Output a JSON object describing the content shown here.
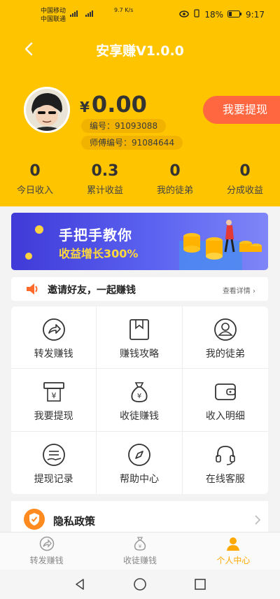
{
  "status_bar": {
    "carrier1": "中国移动",
    "carrier2": "中国联通",
    "network": "9.7 K/s",
    "battery": "18%",
    "time": "9:17"
  },
  "header": {
    "title": "安享赚V1.0.0"
  },
  "profile": {
    "currency": "¥",
    "balance": "0.00",
    "user_id": "编号：91093088",
    "master_id": "师傅编号：91084644",
    "withdraw_button": "我要提现"
  },
  "stats": [
    {
      "value": "0",
      "label": "今日收入"
    },
    {
      "value": "0.3",
      "label": "累计收益"
    },
    {
      "value": "0",
      "label": "我的徒弟"
    },
    {
      "value": "0",
      "label": "分成收益"
    }
  ],
  "banner": {
    "headline": "手把手教你",
    "subline": "收益增长300%"
  },
  "invite": {
    "text": "邀请好友，一起赚钱",
    "more": "查看详情"
  },
  "menu": [
    {
      "label": "转发赚钱",
      "icon": "share-icon"
    },
    {
      "label": "赚钱攻略",
      "icon": "bookmark-icon"
    },
    {
      "label": "我的徒弟",
      "icon": "user-icon"
    },
    {
      "label": "我要提现",
      "icon": "atm-icon"
    },
    {
      "label": "收徒赚钱",
      "icon": "money-bag-icon"
    },
    {
      "label": "收入明细",
      "icon": "wallet-icon"
    },
    {
      "label": "提现记录",
      "icon": "record-icon"
    },
    {
      "label": "帮助中心",
      "icon": "compass-icon"
    },
    {
      "label": "在线客服",
      "icon": "headset-icon"
    }
  ],
  "privacy": {
    "label": "隐私政策"
  },
  "tabbar": [
    {
      "label": "转发赚钱",
      "icon": "share-icon"
    },
    {
      "label": "收徒赚钱",
      "icon": "money-bag-icon"
    },
    {
      "label": "个人中心",
      "icon": "person-icon"
    }
  ],
  "colors": {
    "brand_yellow": "#ffc400",
    "withdraw_orange": "#ff6740",
    "active_tab": "#ffa800"
  }
}
